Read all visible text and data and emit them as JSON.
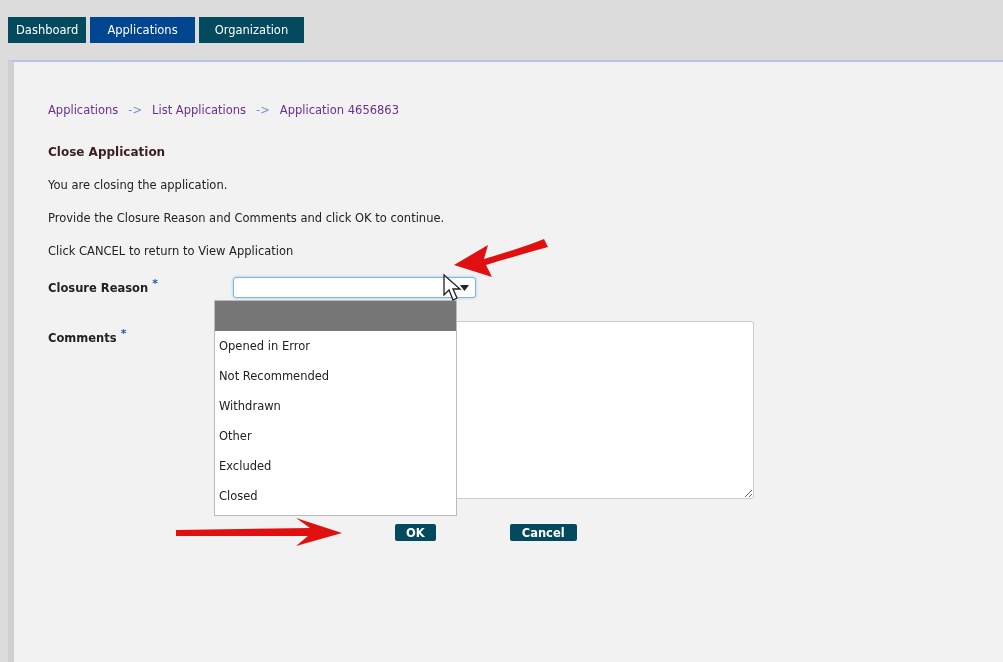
{
  "tabs": [
    {
      "label": "Dashboard",
      "selected": false
    },
    {
      "label": "Applications",
      "selected": true
    },
    {
      "label": "Organization",
      "selected": false
    }
  ],
  "breadcrumb": [
    "Applications",
    "List Applications",
    "Application 4656863"
  ],
  "breadcrumb_separator": "->",
  "heading": "Close Application",
  "paragraphs": [
    "You are closing the application.",
    "Provide the Closure Reason and Comments and click OK to continue.",
    "Click CANCEL to return to View Application"
  ],
  "form": {
    "closure_reason": {
      "label": "Closure Reason",
      "required": true,
      "required_mark": "*",
      "open": true,
      "blank_option_highlighted": true,
      "options": [
        {
          "label": "Opened in Error",
          "selected": false
        },
        {
          "label": "Not Recommended",
          "selected": false
        },
        {
          "label": "Withdrawn",
          "selected": false
        },
        {
          "label": "Other",
          "selected": false
        },
        {
          "label": "Excluded",
          "selected": false
        },
        {
          "label": "Closed",
          "selected": false
        }
      ]
    },
    "comments": {
      "label": "Comments",
      "required": true,
      "required_mark": "*"
    }
  },
  "buttons": [
    {
      "label": "OK"
    },
    {
      "label": "Cancel"
    }
  ]
}
